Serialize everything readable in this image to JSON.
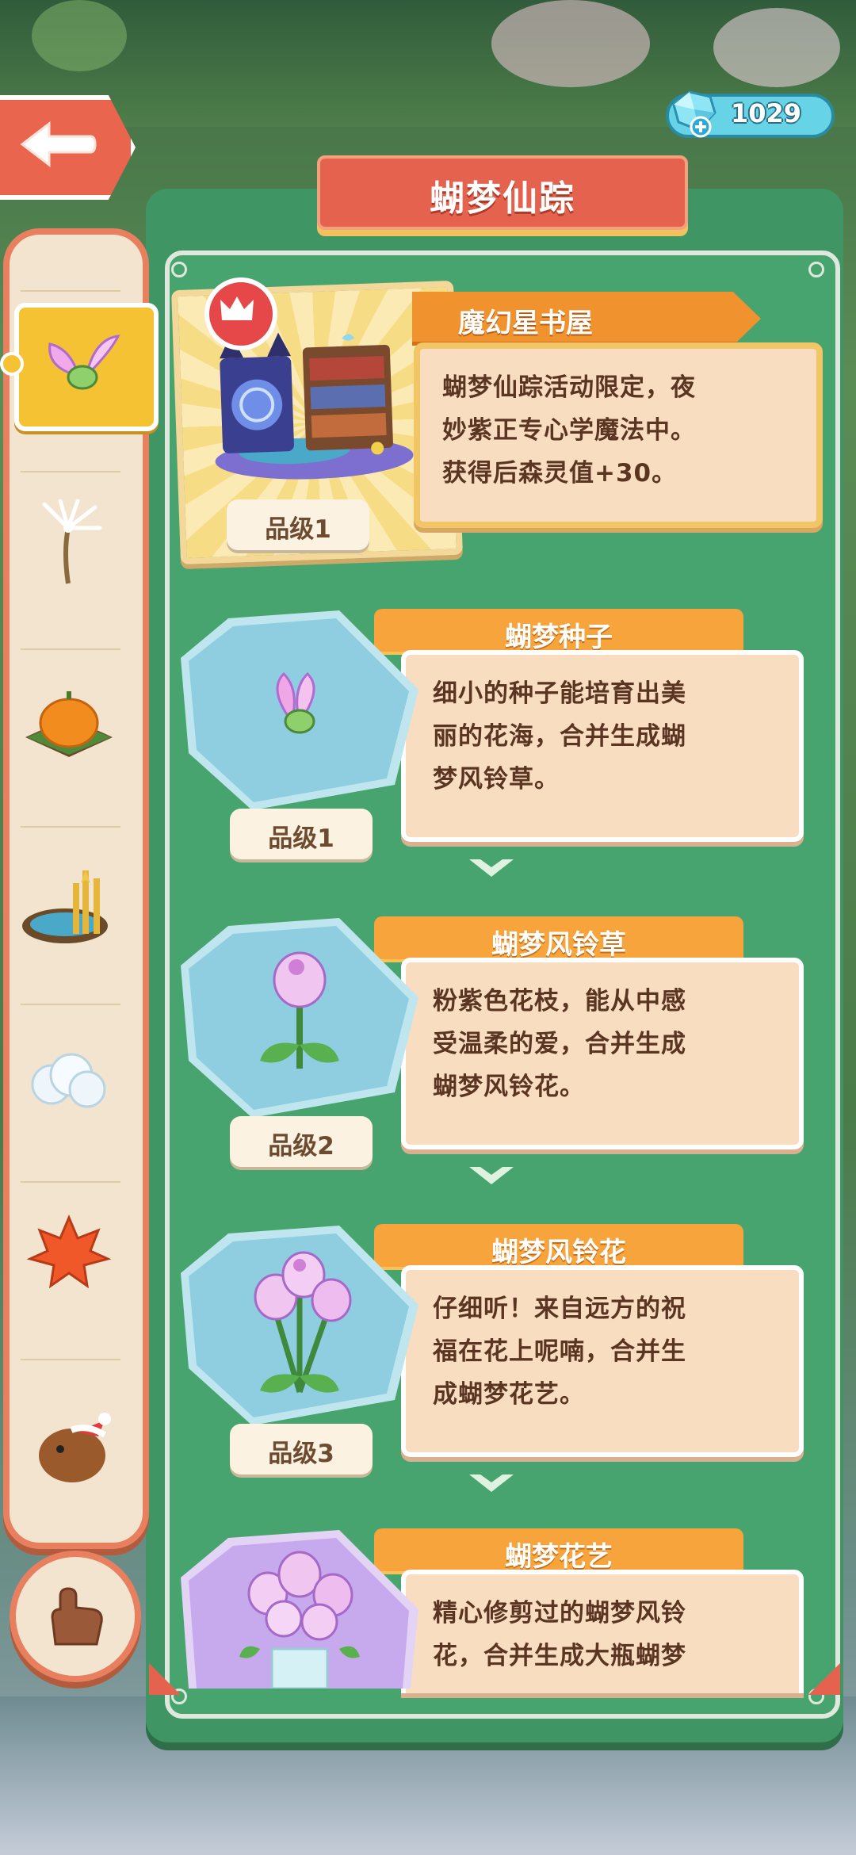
{
  "currency": {
    "value": "1029",
    "icon": "gem-icon",
    "add_icon": "plus-icon"
  },
  "header": {
    "title": "蝴梦仙踪",
    "back_icon": "back-arrow-icon"
  },
  "sidebar": {
    "items": [
      {
        "name": "butterfly-seed-icon",
        "selected": true
      },
      {
        "name": "dandelion-icon",
        "selected": false
      },
      {
        "name": "pumpkin-icon",
        "selected": false
      },
      {
        "name": "wheat-pond-icon",
        "selected": false
      },
      {
        "name": "cotton-icon",
        "selected": false
      },
      {
        "name": "maple-leaf-icon",
        "selected": false
      },
      {
        "name": "christmas-bird-icon",
        "selected": false
      }
    ],
    "hand_icon": "pointing-hand-icon"
  },
  "featured": {
    "name": "魔幻星书屋",
    "description": [
      "蝴梦仙踪活动限定，夜",
      "妙紫正专心学魔法中。",
      "获得后森灵值+30。"
    ],
    "grade": "品级1",
    "badge_icon": "crown-icon"
  },
  "items": [
    {
      "name": "蝴梦种子",
      "grade": "品级1",
      "description": [
        "细小的种子能培育出美",
        "丽的花海，合并生成蝴",
        "梦风铃草。"
      ]
    },
    {
      "name": "蝴梦风铃草",
      "grade": "品级2",
      "description": [
        "粉紫色花枝，能从中感",
        "受温柔的爱，合并生成",
        "蝴梦风铃花。"
      ]
    },
    {
      "name": "蝴梦风铃花",
      "grade": "品级3",
      "description": [
        "仔细听！来自远方的祝",
        "福在花上呢喃，合并生",
        "成蝴梦花艺。"
      ]
    },
    {
      "name": "蝴梦花艺",
      "grade": "",
      "description": [
        "精心修剪过的蝴梦风铃",
        "花，合并生成大瓶蝴梦"
      ]
    }
  ],
  "colors": {
    "panel": "#3f9563",
    "accent": "#e5634e",
    "tab": "#f6a43b",
    "sidebar_border": "#e8805f"
  }
}
